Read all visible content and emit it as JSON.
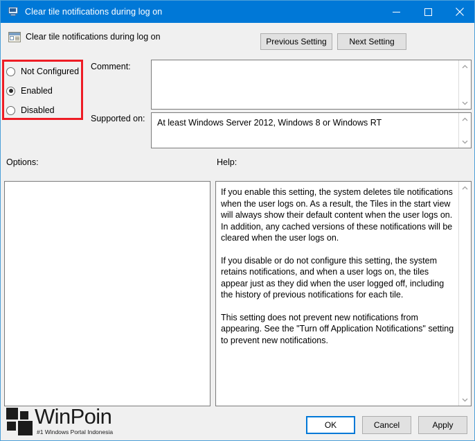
{
  "window": {
    "title": "Clear tile notifications during log on",
    "title_icon": "monitor-icon",
    "controls": {
      "minimize": "minimize-icon",
      "maximize": "maximize-icon",
      "close": "close-icon"
    },
    "accent_color": "#0078d7",
    "border_color": "#4ca0d8"
  },
  "header": {
    "icon": "policy-setting-icon",
    "title": "Clear tile notifications during log on",
    "previous_setting_label": "Previous Setting",
    "next_setting_label": "Next Setting"
  },
  "state_options": {
    "selected": "Enabled",
    "items": [
      {
        "label": "Not Configured",
        "checked": false
      },
      {
        "label": "Enabled",
        "checked": true
      },
      {
        "label": "Disabled",
        "checked": false
      }
    ],
    "highlight_color": "#ee1c25"
  },
  "fields": {
    "comment_label": "Comment:",
    "comment_value": "",
    "supported_on_label": "Supported on:",
    "supported_on_value": "At least Windows Server 2012, Windows 8 or Windows RT"
  },
  "panels": {
    "options_label": "Options:",
    "options_value": "",
    "help_label": "Help:",
    "help_paragraphs": [
      "If you enable this setting, the system deletes tile notifications when the user logs on. As a result, the Tiles in the start view will always show their default content when the user logs on. In addition, any cached versions of these notifications will be cleared when the user logs on.",
      "If you disable or do not configure this setting, the system retains notifications, and when a user logs on, the tiles appear just as they did when the user logged off, including the history of previous notifications for each tile.",
      "This setting does not prevent new notifications from appearing. See the \"Turn off Application Notifications\" setting to prevent new notifications."
    ]
  },
  "footer": {
    "ok_label": "OK",
    "cancel_label": "Cancel",
    "apply_label": "Apply"
  },
  "watermark": {
    "name": "WinPoin",
    "tagline": "#1 Windows Portal Indonesia"
  }
}
